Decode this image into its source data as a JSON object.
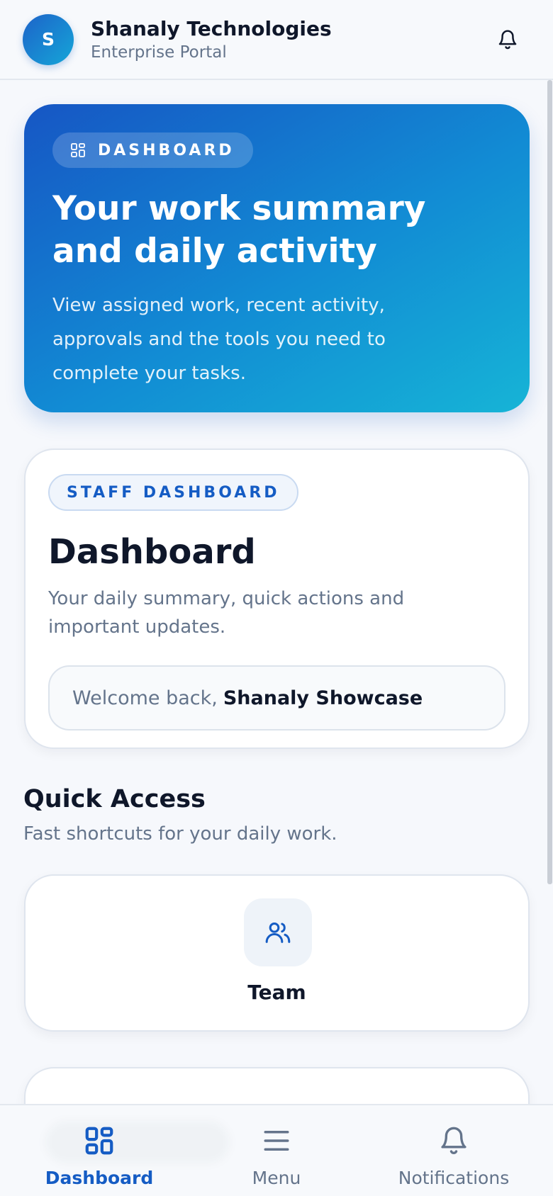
{
  "header": {
    "avatar_initial": "S",
    "brand_name": "Shanaly Technologies",
    "brand_subtitle": "Enterprise Portal",
    "bell_icon": "bell-icon"
  },
  "hero": {
    "badge_icon": "grid-icon",
    "badge_label": "DASHBOARD",
    "title_line1": "Your work summary",
    "title_line2": "and daily activity",
    "description": "View assigned work, recent activity, approvals and the tools you need to complete your tasks."
  },
  "staff_card": {
    "badge_label": "STAFF DASHBOARD",
    "title": "Dashboard",
    "description": "Your daily summary, quick actions and important updates.",
    "welcome_prefix": "Welcome back,",
    "welcome_name": "Shanaly Showcase"
  },
  "quick_access": {
    "title": "Quick Access",
    "subtitle": "Fast shortcuts for your daily work.",
    "items": [
      {
        "label": "Team",
        "icon": "users-icon"
      }
    ]
  },
  "bottom_nav": {
    "items": [
      {
        "label": "Dashboard",
        "icon": "grid-icon",
        "active": true
      },
      {
        "label": "Menu",
        "icon": "hamburger-menu-icon",
        "active": false
      },
      {
        "label": "Notifications",
        "icon": "bell-icon",
        "active": false
      }
    ]
  },
  "colors": {
    "accent": "#155cc4",
    "hero_start": "#1656c4",
    "hero_end": "#16b4d6",
    "text_primary": "#0f172a",
    "text_muted": "#64748b",
    "background": "#f6f8fc"
  }
}
